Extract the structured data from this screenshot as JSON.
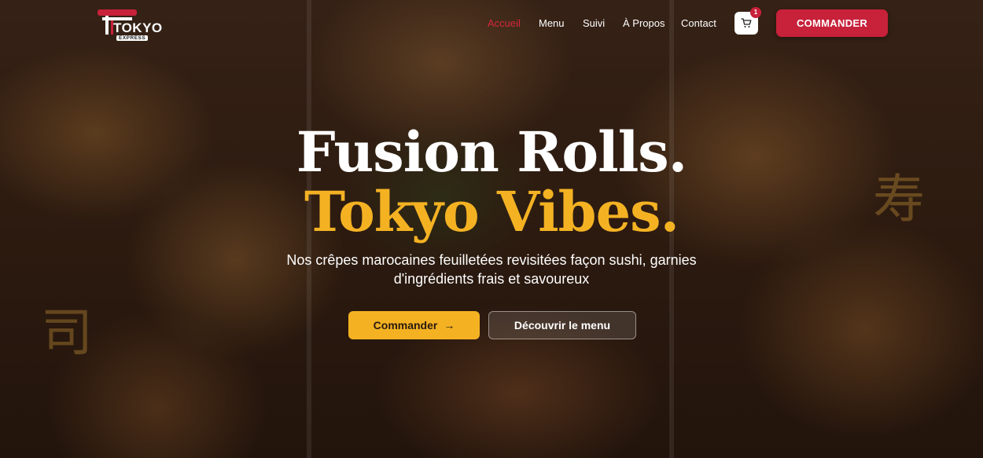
{
  "brand": {
    "name": "TOKYO",
    "tagline": "EXPRESS"
  },
  "nav": {
    "links": [
      {
        "label": "Accueil",
        "active": true
      },
      {
        "label": "Menu",
        "active": false
      },
      {
        "label": "Suivi",
        "active": false
      },
      {
        "label": "À Propos",
        "active": false
      },
      {
        "label": "Contact",
        "active": false
      }
    ],
    "cart_count": "1",
    "cta_label": "COMMANDER"
  },
  "hero": {
    "title_line1": "Fusion Rolls.",
    "title_line2": "Tokyo Vibes.",
    "subtitle": "Nos crêpes marocaines feuilletées revisitées façon sushi, garnies d'ingrédients frais et savoureux",
    "primary_button": "Commander",
    "primary_button_icon": "→",
    "secondary_button": "Découvrir le menu",
    "decor_kanji": [
      "寿",
      "司"
    ]
  },
  "colors": {
    "accent_red": "#c8213a",
    "accent_gold": "#f4b223",
    "text_white": "#ffffff"
  }
}
